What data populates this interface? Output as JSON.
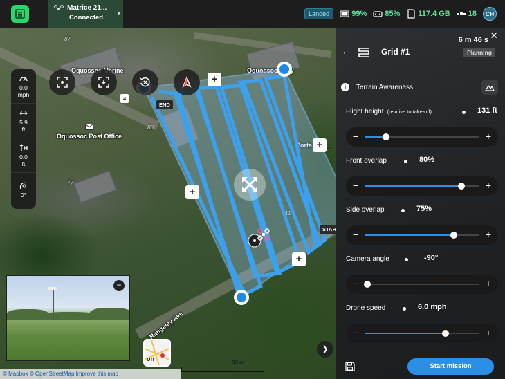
{
  "topbar": {
    "drone_name": "Matrice 21...",
    "drone_status": "Connected",
    "flight_state": "Landed",
    "drone_battery": "99%",
    "controller_battery": "85%",
    "storage": "117.4 GB",
    "satellites": "18",
    "user_initials": "CH"
  },
  "telemetry": {
    "speed_value": "0.0",
    "speed_unit": "mph",
    "distance_value": "5.9",
    "distance_unit": "ft",
    "height_value": "0.0",
    "height_unit": "ft",
    "heading_value": "0°"
  },
  "map": {
    "labels": {
      "marine": "Oquossoc Marine",
      "grocery": "Oquossoc ...ery",
      "post_office": "Oquossoc Post Office",
      "portage": "Porta...ge ...",
      "rangeley": "Rangeley Ave"
    },
    "numbers": [
      "87",
      "88",
      "77",
      "11"
    ],
    "end_tag": "END",
    "start_tag": "START",
    "pip_badge": "4",
    "map_style_label": "on",
    "scale_label": "60 m",
    "attribution": "© Mapbox © OpenStreetMap Improve this map"
  },
  "panel": {
    "mission_name": "Grid #1",
    "duration": "6 m 46 s",
    "status": "Planning",
    "terrain_label": "Terrain Awareness",
    "start_button": "Start mission",
    "settings": [
      {
        "label": "Flight height",
        "sub": "(relative to take-off)",
        "value": "131 ft",
        "level": 0.18
      },
      {
        "label": "Front overlap",
        "sub": "",
        "value": "80%",
        "level": 0.85
      },
      {
        "label": "Side overlap",
        "sub": "",
        "value": "75%",
        "level": 0.78
      },
      {
        "label": "Camera angle",
        "sub": "",
        "value": "-90°",
        "level": 0.02
      },
      {
        "label": "Drone speed",
        "sub": "",
        "value": "6.0 mph",
        "level": 0.71
      }
    ]
  },
  "colors": {
    "accent": "#2e8ee8",
    "brand": "#2fd36c",
    "status_ok": "#5de29b"
  }
}
